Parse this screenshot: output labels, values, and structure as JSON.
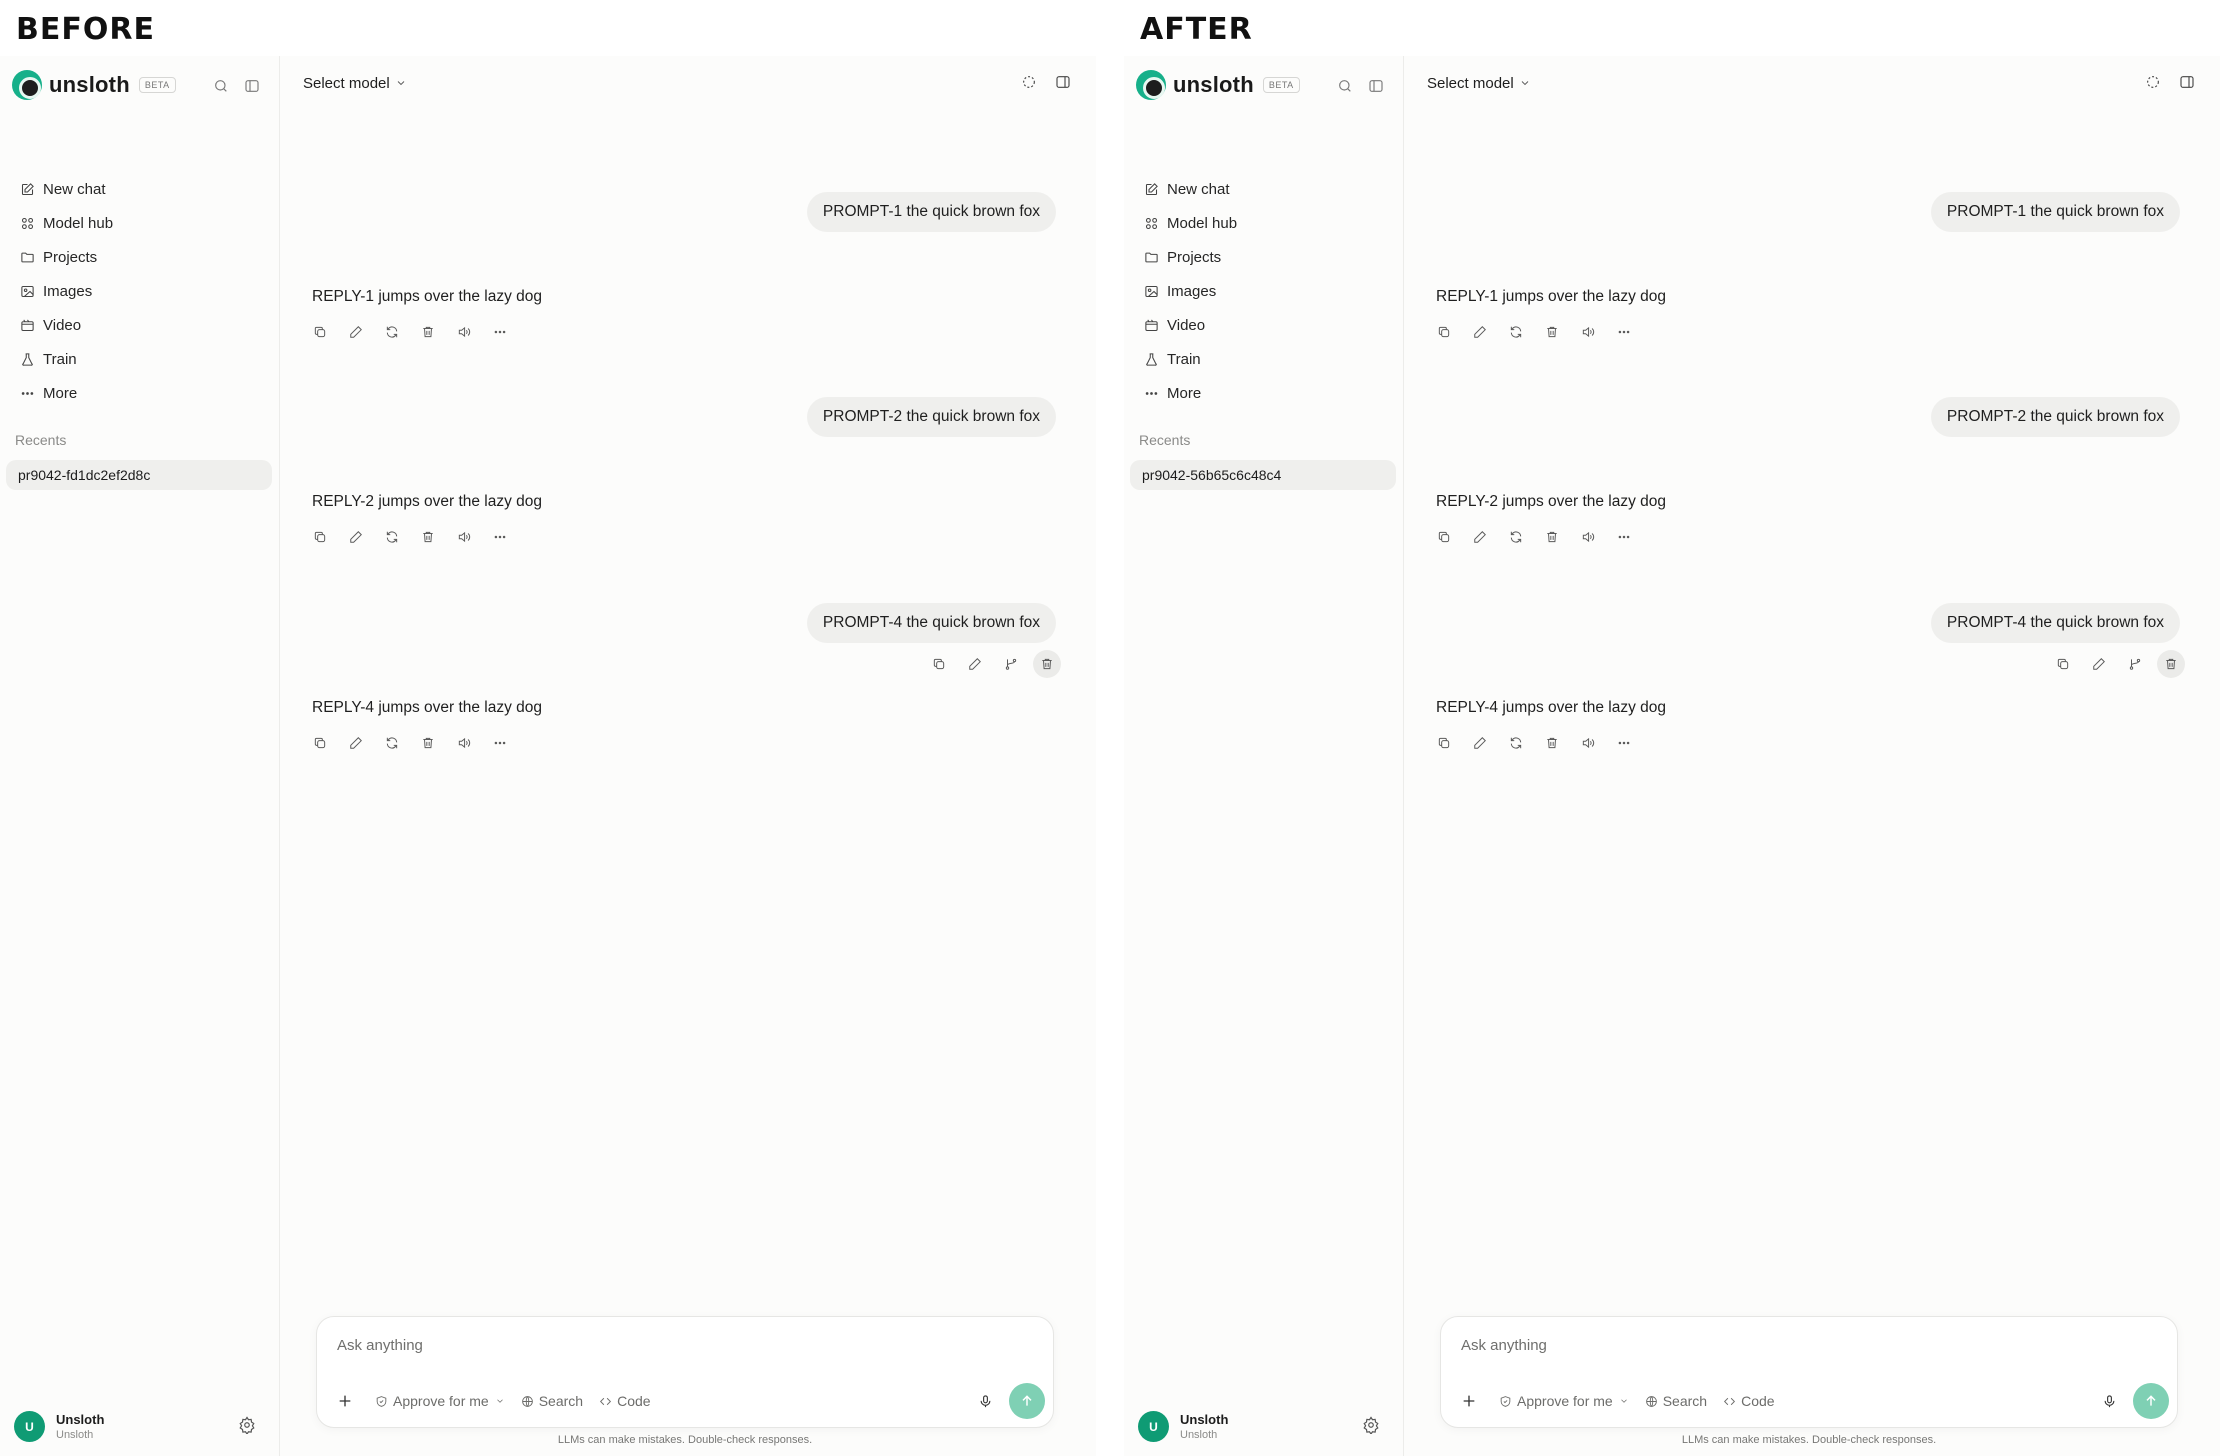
{
  "titles": {
    "before": "BEFORE",
    "after": "AFTER"
  },
  "common": {
    "brand": {
      "name": "unsloth",
      "badge": "BETA"
    },
    "nav": [
      {
        "label": "New chat",
        "icon": "edit-icon"
      },
      {
        "label": "Model hub",
        "icon": "grid-icon"
      },
      {
        "label": "Projects",
        "icon": "folder-icon"
      },
      {
        "label": "Images",
        "icon": "image-icon"
      },
      {
        "label": "Video",
        "icon": "video-icon"
      },
      {
        "label": "Train",
        "icon": "flask-icon"
      },
      {
        "label": "More",
        "icon": "ellipsis-icon"
      }
    ],
    "recents_label": "Recents",
    "user": {
      "initial": "U",
      "name": "Unsloth",
      "sub": "Unsloth"
    },
    "model_select": "Select model",
    "messages": {
      "prompt1": "PROMPT-1 the quick brown fox",
      "reply1": "REPLY-1 jumps over the lazy dog",
      "prompt2": "PROMPT-2 the quick brown fox",
      "reply2": "REPLY-2 jumps over the lazy dog",
      "prompt4": "PROMPT-4 the quick brown fox",
      "reply4": "REPLY-4 jumps over the lazy dog"
    },
    "composer": {
      "placeholder": "Ask anything",
      "approve": "Approve for me",
      "search": "Search",
      "code": "Code"
    },
    "disclaimer": "LLMs can make mistakes. Double-check responses.",
    "colors": {
      "accent": "#17b08a",
      "send": "#7fd0b4",
      "bubble": "#efefed"
    }
  },
  "before": {
    "recent": "pr9042-fd1dc2ef2d8c"
  },
  "after": {
    "recent": "pr9042-56b65c6c48c4"
  }
}
